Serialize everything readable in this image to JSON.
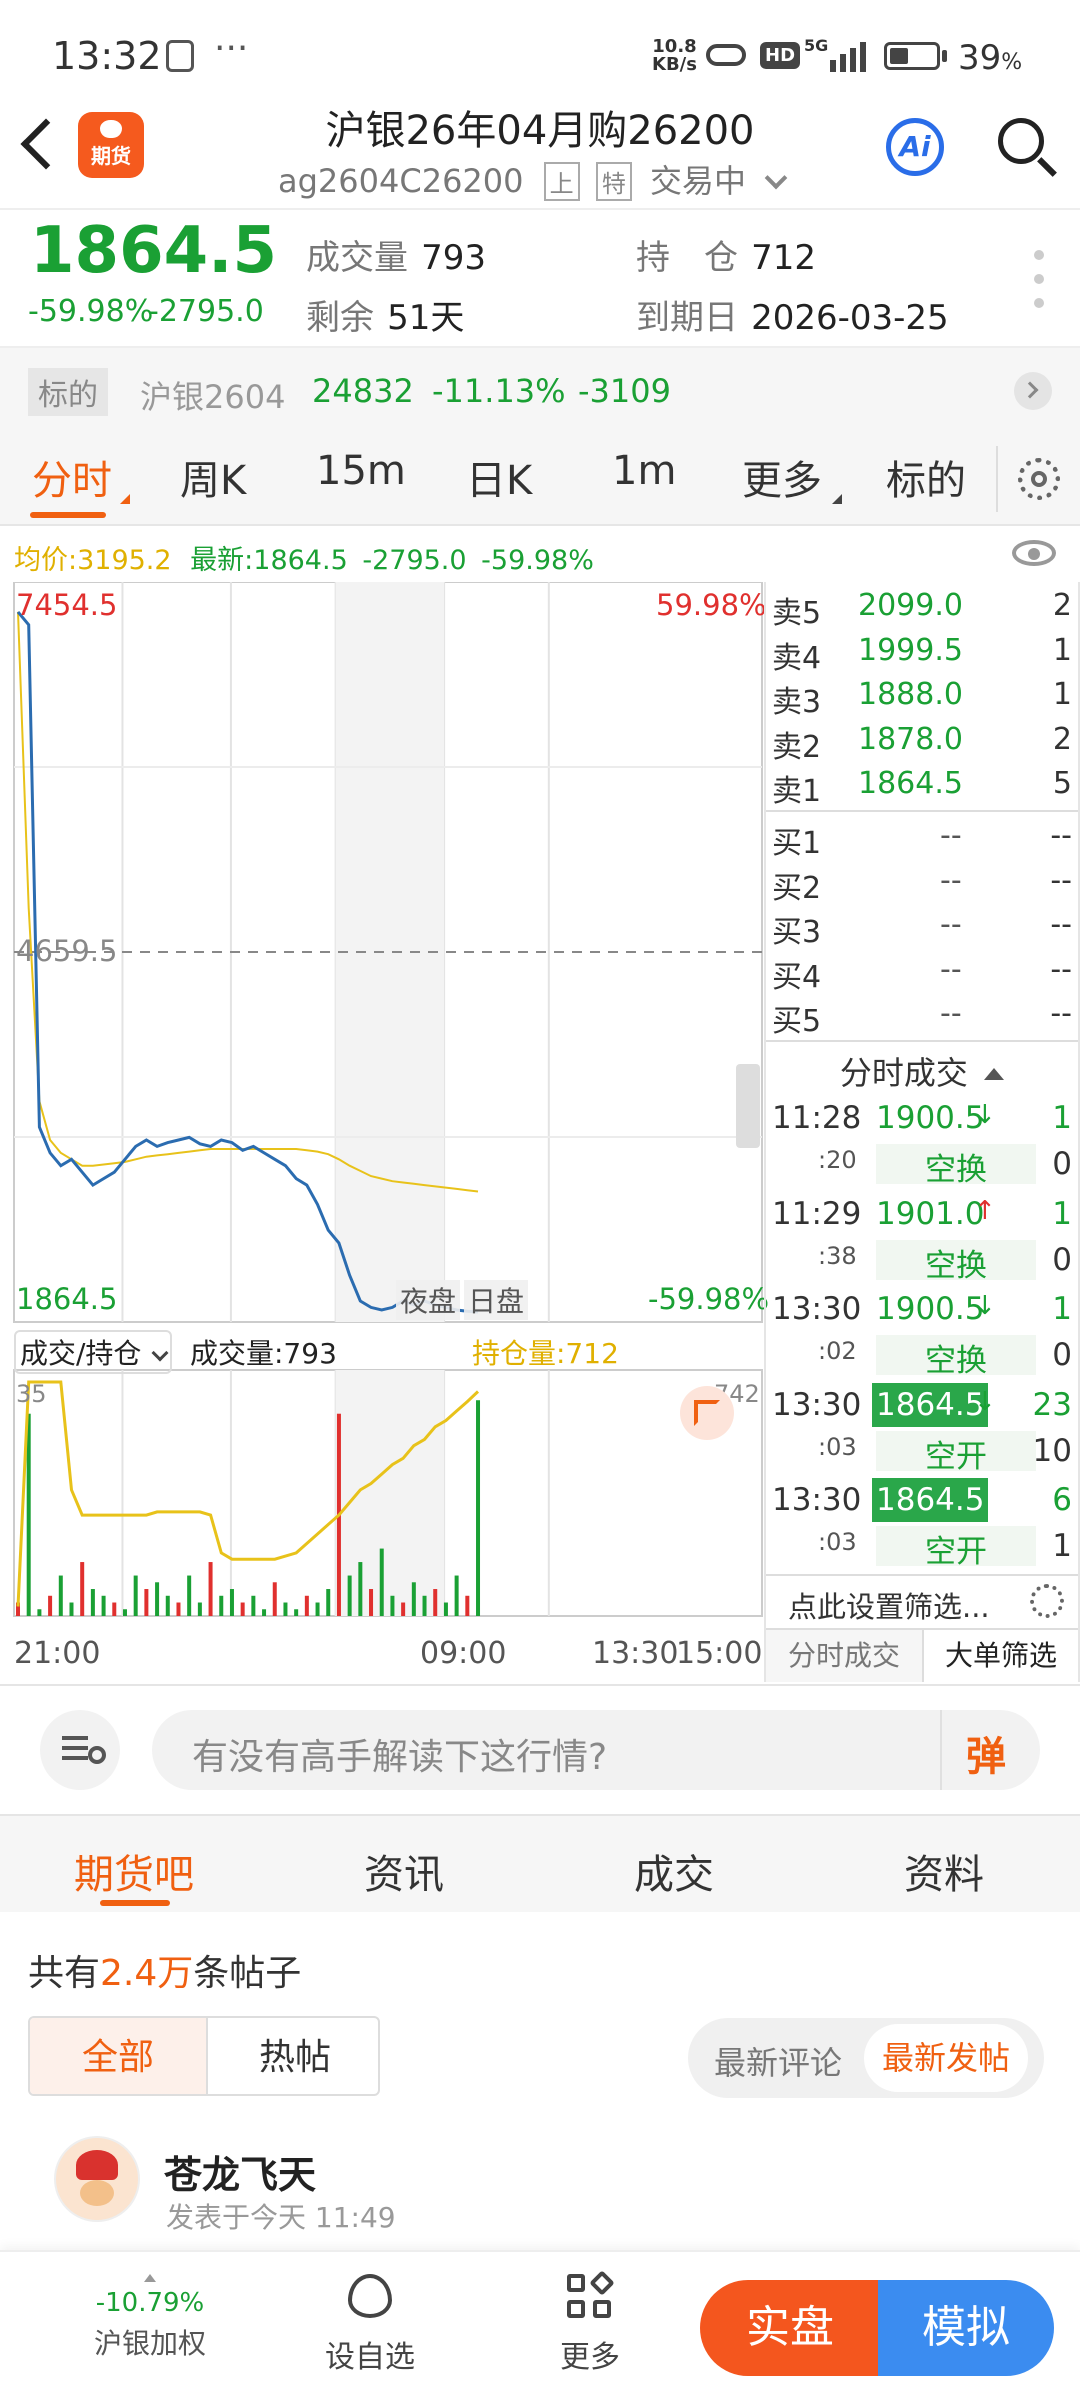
{
  "status_bar": {
    "time": "13:32",
    "net_speed": "10.8",
    "net_unit": "KB/s",
    "hd": "HD",
    "sig": "5G",
    "battery": "39",
    "battery_unit": "%"
  },
  "header": {
    "logo_text": "期货",
    "title": "沪银26年04月购26200",
    "code": "ag2604C26200",
    "tag_up": "上",
    "tag_special": "特",
    "trading_status": "交易中",
    "ai_label": "Ai"
  },
  "quote": {
    "price": "1864.5",
    "change_pct": "-59.98%",
    "change": "-2795.0",
    "volume_label": "成交量",
    "volume": "793",
    "remain_label": "剩余",
    "remain": "51天",
    "oi_label": "持　仓",
    "oi": "712",
    "expiry_label": "到期日",
    "expiry": "2026-03-25"
  },
  "underlying": {
    "tag": "标的",
    "name": "沪银2604",
    "price": "24832",
    "pct": "-11.13%",
    "change": "-3109"
  },
  "chart_tabs": [
    "分时",
    "周K",
    "15m",
    "日K",
    "1m",
    "更多",
    "标的"
  ],
  "info_line": {
    "avg": "均价:3195.2",
    "latest": "最新:1864.5",
    "chg": "-2795.0",
    "pct": "-59.98%"
  },
  "chart_labels": {
    "top_price": "7454.5",
    "top_pct": "59.98%",
    "mid_price": "4659.5",
    "bottom_price": "1864.5",
    "bottom_pct": "-59.98%",
    "night": "夜盘",
    "day": "日盘",
    "sub_selector": "成交/持仓",
    "sub_volume": "成交量:793",
    "sub_oi": "持仓量:712",
    "sub_left_max": "35",
    "sub_right_max": "742",
    "x_start": "21:00",
    "x_mid": "09:00",
    "x_now": "13:30",
    "x_end": "15:00"
  },
  "chart_data": {
    "type": "line",
    "title": "",
    "ylim": [
      1864.5,
      7454.5
    ],
    "x_labels": [
      "21:00",
      "09:00",
      "13:30",
      "15:00"
    ],
    "series": [
      {
        "name": "最新",
        "color": "#2b6cb0",
        "values": [
          7300,
          7200,
          3300,
          3100,
          3000,
          3050,
          2950,
          2850,
          2900,
          2950,
          3050,
          3150,
          3200,
          3150,
          3180,
          3200,
          3220,
          3170,
          3150,
          3200,
          3180,
          3120,
          3150,
          3100,
          3050,
          3000,
          2900,
          2850,
          2700,
          2500,
          2400,
          2150,
          1950,
          1900,
          1880,
          1900,
          1950,
          1920,
          1950,
          1920,
          1900,
          1880,
          1870,
          1864.5
        ]
      },
      {
        "name": "均价",
        "color": "#e8c21a",
        "values": [
          7300,
          5000,
          3500,
          3200,
          3100,
          3050,
          3000,
          3000,
          3010,
          3020,
          3030,
          3050,
          3070,
          3080,
          3090,
          3100,
          3110,
          3120,
          3130,
          3130,
          3130,
          3130,
          3130,
          3130,
          3130,
          3130,
          3130,
          3120,
          3110,
          3090,
          3050,
          3000,
          2960,
          2920,
          2900,
          2880,
          2870,
          2860,
          2850,
          2840,
          2830,
          2820,
          2810,
          2800
        ]
      }
    ],
    "volume": [
      2,
      30,
      1,
      3,
      6,
      2,
      8,
      4,
      3,
      2,
      1,
      6,
      4,
      5,
      3,
      2,
      6,
      2,
      8,
      3,
      4,
      2,
      3,
      1,
      5,
      2,
      1,
      3,
      2,
      4,
      30,
      6,
      8,
      4,
      10,
      3,
      2,
      5,
      3,
      4,
      2,
      6,
      3,
      32
    ],
    "open_interest": [
      30,
      742,
      742,
      742,
      742,
      400,
      320,
      320,
      320,
      320,
      320,
      320,
      320,
      330,
      330,
      330,
      330,
      330,
      320,
      200,
      180,
      180,
      180,
      180,
      180,
      190,
      200,
      230,
      260,
      290,
      320,
      360,
      400,
      420,
      450,
      480,
      500,
      540,
      560,
      600,
      620,
      650,
      680,
      712
    ]
  },
  "order_book": {
    "asks": [
      {
        "label": "卖5",
        "price": "2099.0",
        "qty": "2"
      },
      {
        "label": "卖4",
        "price": "1999.5",
        "qty": "1"
      },
      {
        "label": "卖3",
        "price": "1888.0",
        "qty": "1"
      },
      {
        "label": "卖2",
        "price": "1878.0",
        "qty": "2"
      },
      {
        "label": "卖1",
        "price": "1864.5",
        "qty": "5"
      }
    ],
    "bids": [
      {
        "label": "买1",
        "price": "--",
        "qty": "--"
      },
      {
        "label": "买2",
        "price": "--",
        "qty": "--"
      },
      {
        "label": "买3",
        "price": "--",
        "qty": "--"
      },
      {
        "label": "买4",
        "price": "--",
        "qty": "--"
      },
      {
        "label": "买5",
        "price": "--",
        "qty": "--"
      }
    ]
  },
  "trades_header": "分时成交",
  "trades": [
    {
      "time": "11:28",
      "sec": ":20",
      "price": "1900.5",
      "arrow": "↓",
      "qty": "1",
      "type": "空换",
      "oi": "0",
      "hl": false
    },
    {
      "time": "11:29",
      "sec": ":38",
      "price": "1901.0",
      "arrow": "↑",
      "qty": "1",
      "type": "空换",
      "oi": "0",
      "hl": false
    },
    {
      "time": "13:30",
      "sec": ":02",
      "price": "1900.5",
      "arrow": "↓",
      "qty": "1",
      "type": "空换",
      "oi": "0",
      "hl": false
    },
    {
      "time": "13:30",
      "sec": ":03",
      "price": "1864.5",
      "arrow": "↓",
      "qty": "23",
      "type": "空开",
      "oi": "10",
      "hl": true
    },
    {
      "time": "13:30",
      "sec": ":03",
      "price": "1864.5",
      "arrow": "",
      "qty": "6",
      "type": "空开",
      "oi": "1",
      "hl": true
    }
  ],
  "trades_footer": {
    "filter_setting": "点此设置筛选...",
    "tab_trades": "分时成交",
    "tab_big": "大单筛选"
  },
  "comment_bar": {
    "placeholder": "有没有高手解读下这行情?",
    "danmaku": "弹"
  },
  "content_tabs": [
    "期货吧",
    "资讯",
    "成交",
    "资料"
  ],
  "forum": {
    "count_prefix": "共有",
    "count": "2.4万",
    "count_suffix": "条帖子",
    "filter_all": "全部",
    "filter_hot": "热帖",
    "sort_comment": "最新评论",
    "sort_post": "最新发帖",
    "post_author": "苍龙飞天",
    "post_time": "发表于今天 11:49"
  },
  "bottom_nav": {
    "linked_pct": "-10.79%",
    "linked_name": "沪银加权",
    "watchlist": "设自选",
    "more": "更多",
    "real": "实盘",
    "sim": "模拟"
  },
  "colors": {
    "up": "#e0302e",
    "down": "#1aa034",
    "accent": "#f06011",
    "price_line": "#2b6cb0",
    "avg_line": "#e8c21a",
    "sim_blue": "#3b8cf0"
  }
}
